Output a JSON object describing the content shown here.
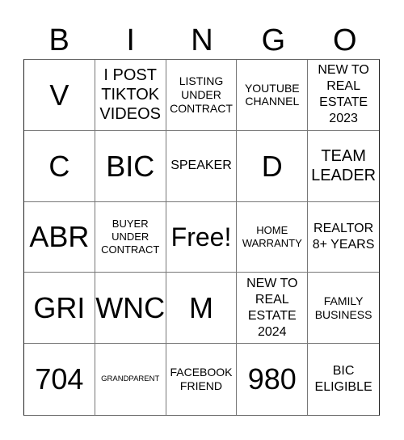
{
  "header": [
    "B",
    "I",
    "N",
    "G",
    "O"
  ],
  "cells": [
    {
      "text": "V",
      "size": "xl"
    },
    {
      "text": "I POST TIKTOK VIDEOS",
      "size": "lg"
    },
    {
      "text": "LISTING UNDER CONTRACT",
      "size": "sm"
    },
    {
      "text": "YOUTUBE CHANNEL",
      "size": "sm"
    },
    {
      "text": "NEW TO REAL ESTATE 2023",
      "size": "md"
    },
    {
      "text": "C",
      "size": "xl"
    },
    {
      "text": "BIC",
      "size": "xl"
    },
    {
      "text": "SPEAKER",
      "size": "md"
    },
    {
      "text": "D",
      "size": "xl"
    },
    {
      "text": "TEAM LEADER",
      "size": "lg"
    },
    {
      "text": "ABR",
      "size": "xl"
    },
    {
      "text": "BUYER UNDER CONTRACT",
      "size": "xs"
    },
    {
      "text": "Free!",
      "size": "free"
    },
    {
      "text": "HOME WARRANTY",
      "size": "xs"
    },
    {
      "text": "REALTOR 8+ YEARS",
      "size": "md"
    },
    {
      "text": "GRI",
      "size": "xl"
    },
    {
      "text": "WNC",
      "size": "xl"
    },
    {
      "text": "M",
      "size": "xl"
    },
    {
      "text": "NEW TO REAL ESTATE 2024",
      "size": "md"
    },
    {
      "text": "FAMILY BUSINESS",
      "size": "sm"
    },
    {
      "text": "704",
      "size": "xl"
    },
    {
      "text": "GRANDPARENT",
      "size": "xxs"
    },
    {
      "text": "FACEBOOK FRIEND",
      "size": "sm"
    },
    {
      "text": "980",
      "size": "xl"
    },
    {
      "text": "BIC ELIGIBLE",
      "size": "md"
    }
  ]
}
